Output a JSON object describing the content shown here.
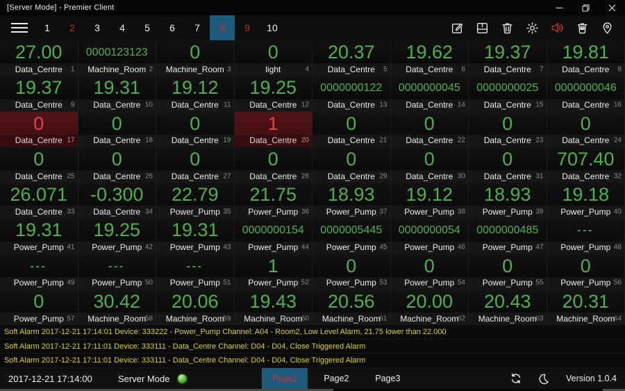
{
  "window": {
    "title": "[Server Mode] - Premier Client",
    "controls": {
      "minimize": "minimize",
      "restore": "restore",
      "close": "close"
    }
  },
  "toolbar": {
    "tabs": [
      {
        "label": "1",
        "state": "normal"
      },
      {
        "label": "2",
        "state": "red"
      },
      {
        "label": "3",
        "state": "normal"
      },
      {
        "label": "4",
        "state": "normal"
      },
      {
        "label": "5",
        "state": "normal"
      },
      {
        "label": "6",
        "state": "normal"
      },
      {
        "label": "7",
        "state": "normal"
      },
      {
        "label": "8",
        "state": "active"
      },
      {
        "label": "9",
        "state": "red"
      },
      {
        "label": "10",
        "state": "normal"
      }
    ],
    "icons": [
      "edit-icon",
      "save-icon",
      "trash-icon",
      "settings-gear-icon",
      "volume-icon",
      "clear-images-icon",
      "location-pin-icon"
    ]
  },
  "grid": {
    "cells": [
      {
        "v": "27.00",
        "l": "Data_Centre",
        "n": 1,
        "a": 0
      },
      {
        "v": "0000123123",
        "l": "Machine_Room",
        "n": 2,
        "a": 0
      },
      {
        "v": "0",
        "l": "Machine_Room",
        "n": 3,
        "a": 0
      },
      {
        "v": "0",
        "l": "light",
        "n": 4,
        "a": 0
      },
      {
        "v": "20.37",
        "l": "Data_Centre",
        "n": 5,
        "a": 0
      },
      {
        "v": "19.62",
        "l": "Data_Centre",
        "n": 6,
        "a": 0
      },
      {
        "v": "19.37",
        "l": "Data_Centre",
        "n": 7,
        "a": 0
      },
      {
        "v": "19.81",
        "l": "Data_Centre",
        "n": 8,
        "a": 0
      },
      {
        "v": "19.37",
        "l": "Data_Centre",
        "n": 9,
        "a": 0
      },
      {
        "v": "19.31",
        "l": "Data_Centre",
        "n": 10,
        "a": 0
      },
      {
        "v": "19.12",
        "l": "Data_Centre",
        "n": 11,
        "a": 0
      },
      {
        "v": "19.25",
        "l": "Data_Centre",
        "n": 12,
        "a": 0
      },
      {
        "v": "0000000122",
        "l": "Data_Centre",
        "n": 13,
        "a": 0
      },
      {
        "v": "0000000045",
        "l": "Data_Centre",
        "n": 14,
        "a": 0
      },
      {
        "v": "0000000025",
        "l": "Data_Centre",
        "n": 15,
        "a": 0
      },
      {
        "v": "0000000046",
        "l": "Data_Centre",
        "n": 16,
        "a": 0
      },
      {
        "v": "0",
        "l": "Data_Centre",
        "n": 17,
        "a": 1
      },
      {
        "v": "0",
        "l": "Data_Centre",
        "n": 18,
        "a": 0
      },
      {
        "v": "0",
        "l": "Data_Centre",
        "n": 19,
        "a": 0
      },
      {
        "v": "1",
        "l": "Data_Centre",
        "n": 20,
        "a": 1
      },
      {
        "v": "0",
        "l": "Data_Centre",
        "n": 21,
        "a": 0
      },
      {
        "v": "0",
        "l": "Data_Centre",
        "n": 22,
        "a": 0
      },
      {
        "v": "0",
        "l": "Data_Centre",
        "n": 23,
        "a": 0
      },
      {
        "v": "0",
        "l": "Data_Centre",
        "n": 24,
        "a": 0
      },
      {
        "v": "0",
        "l": "Data_Centre",
        "n": 25,
        "a": 0
      },
      {
        "v": "0",
        "l": "Data_Centre",
        "n": 26,
        "a": 0
      },
      {
        "v": "0",
        "l": "Data_Centre",
        "n": 27,
        "a": 0
      },
      {
        "v": "0",
        "l": "Data_Centre",
        "n": 28,
        "a": 0
      },
      {
        "v": "0",
        "l": "Data_Centre",
        "n": 29,
        "a": 0
      },
      {
        "v": "0",
        "l": "Data_Centre",
        "n": 30,
        "a": 0
      },
      {
        "v": "0",
        "l": "Data_Centre",
        "n": 31,
        "a": 0
      },
      {
        "v": "707.40",
        "l": "Data_Centre",
        "n": 32,
        "a": 0
      },
      {
        "v": "26.071",
        "l": "Data_Centre",
        "n": 33,
        "a": 0
      },
      {
        "v": "-0.300",
        "l": "Data_Centre",
        "n": 34,
        "a": 0
      },
      {
        "v": "22.79",
        "l": "Power_Pump",
        "n": 35,
        "a": 0
      },
      {
        "v": "21.75",
        "l": "Power_Pump",
        "n": 36,
        "a": 0
      },
      {
        "v": "18.93",
        "l": "Power_Pump",
        "n": 37,
        "a": 0
      },
      {
        "v": "19.12",
        "l": "Power_Pump",
        "n": 38,
        "a": 0
      },
      {
        "v": "18.93",
        "l": "Power_Pump",
        "n": 39,
        "a": 0
      },
      {
        "v": "19.18",
        "l": "Power_Pump",
        "n": 40,
        "a": 0
      },
      {
        "v": "19.31",
        "l": "Power_Pump",
        "n": 41,
        "a": 0
      },
      {
        "v": "19.25",
        "l": "Power_Pump",
        "n": 42,
        "a": 0
      },
      {
        "v": "19.31",
        "l": "Power_Pump",
        "n": 43,
        "a": 0
      },
      {
        "v": "0000000154",
        "l": "Power_Pump",
        "n": 44,
        "a": 0
      },
      {
        "v": "0000005445",
        "l": "Power_Pump",
        "n": 45,
        "a": 0
      },
      {
        "v": "0000000054",
        "l": "Power_Pump",
        "n": 46,
        "a": 0
      },
      {
        "v": "0000000485",
        "l": "Power_Pump",
        "n": 47,
        "a": 0
      },
      {
        "v": "---",
        "l": "Power_Pump",
        "n": 48,
        "a": 0
      },
      {
        "v": "---",
        "l": "Power_Pump",
        "n": 49,
        "a": 0
      },
      {
        "v": "---",
        "l": "Power_Pump",
        "n": 50,
        "a": 0
      },
      {
        "v": "---",
        "l": "Power_Pump",
        "n": 51,
        "a": 0
      },
      {
        "v": "1",
        "l": "Power_Pump",
        "n": 52,
        "a": 0
      },
      {
        "v": "0",
        "l": "Power_Pump",
        "n": 53,
        "a": 0
      },
      {
        "v": "0",
        "l": "Power_Pump",
        "n": 54,
        "a": 0
      },
      {
        "v": "0",
        "l": "Power_Pump",
        "n": 55,
        "a": 0
      },
      {
        "v": "0",
        "l": "Power_Pump",
        "n": 56,
        "a": 0
      },
      {
        "v": "0",
        "l": "Power_Pump",
        "n": 57,
        "a": 0
      },
      {
        "v": "30.42",
        "l": "Machine_Room",
        "n": 58,
        "a": 0
      },
      {
        "v": "20.06",
        "l": "Machine_Room",
        "n": 59,
        "a": 0
      },
      {
        "v": "19.43",
        "l": "Machine_Room",
        "n": 60,
        "a": 0
      },
      {
        "v": "20.56",
        "l": "Machine_Room",
        "n": 61,
        "a": 0
      },
      {
        "v": "20.00",
        "l": "Machine_Room",
        "n": 62,
        "a": 0
      },
      {
        "v": "20.43",
        "l": "Machine_Room",
        "n": 63,
        "a": 0
      },
      {
        "v": "20.31",
        "l": "Machine_Room",
        "n": 64,
        "a": 0
      }
    ]
  },
  "alarms": [
    "Soft Alarm 2017-12-21 17:14:01 Device: 333222 - Power_Pump Channel: A04 - Room2, Low Level Alarm, 21.75 lower than 22.000",
    "Soft Alarm 2017-12-21 17:11:01 Device: 333111 - Data_Centre Channel: D04 - D04, Close Triggered Alarm",
    "Soft Alarm 2017-12-21 17:11:01 Device: 333111 - Data_Centre Channel: D04 - D04, Close Triggered Alarm"
  ],
  "statusbar": {
    "datetime": "2017-12-21 17:14:00",
    "mode_label": "Server Mode",
    "mode_status_color": "#59c23a",
    "pages": [
      {
        "label": "Page1",
        "active": true
      },
      {
        "label": "Page2",
        "active": false
      },
      {
        "label": "Page3",
        "active": false
      }
    ],
    "icons": [
      "sync-icon",
      "moon-icon"
    ],
    "version": "Version 1.0.4"
  },
  "colors": {
    "value_green": "#50b050",
    "alarm_red": "#e24343",
    "alarm_cell_bg": "#4a1417",
    "tab_active_blue": "#1e5a7c",
    "tab_red": "#b23434",
    "alarm_text_yellow": "#ddd22b"
  }
}
